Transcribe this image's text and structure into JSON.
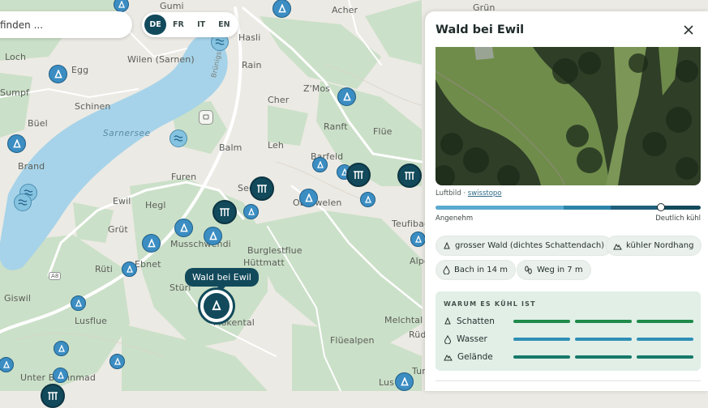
{
  "map": {
    "colors": {
      "base": "#eceae4",
      "forest": "#c9dfc6",
      "lake": "#a6d3e9",
      "road": "#ffffff"
    },
    "lake_label": "Sarnersee",
    "place_labels": [
      {
        "text": "Gumi"
      },
      {
        "text": "Acher"
      },
      {
        "text": "Grün"
      },
      {
        "text": "Hasli"
      },
      {
        "text": "Loch"
      },
      {
        "text": "Wilen (Sarnen)"
      },
      {
        "text": "Egg"
      },
      {
        "text": "Rain"
      },
      {
        "text": "Z'Mos"
      },
      {
        "text": "Sumpf"
      },
      {
        "text": "Schinen"
      },
      {
        "text": "Cher"
      },
      {
        "text": "Büel"
      },
      {
        "text": "Ranft"
      },
      {
        "text": "Flüe"
      },
      {
        "text": "Balm"
      },
      {
        "text": "Leh"
      },
      {
        "text": "Brand"
      },
      {
        "text": "Barfeld"
      },
      {
        "text": "Furen"
      },
      {
        "text": "Sed"
      },
      {
        "text": "Ewil"
      },
      {
        "text": "Hegl"
      },
      {
        "text": "Oberwelen"
      },
      {
        "text": "Teufibach"
      },
      {
        "text": "Grüt"
      },
      {
        "text": "Musschwendi"
      },
      {
        "text": "Burglestflue"
      },
      {
        "text": "Alpel"
      },
      {
        "text": "Ebnet"
      },
      {
        "text": "Rüti"
      },
      {
        "text": "Hüttmatt"
      },
      {
        "text": "Stüri"
      },
      {
        "text": "Giswil"
      },
      {
        "text": "Mokental"
      },
      {
        "text": "Lusflue"
      },
      {
        "text": "Melchtal"
      },
      {
        "text": "Rüdi"
      },
      {
        "text": "Flüealpen"
      },
      {
        "text": "Unter Brunnmad"
      },
      {
        "text": "Lus"
      },
      {
        "text": "Tur"
      }
    ],
    "road_labels": [
      {
        "text": "Brünigstrasse"
      },
      {
        "text": "A8"
      }
    ],
    "markers_count_note": "",
    "selected_marker_label": "Wald bei Ewil"
  },
  "search": {
    "placeholder": "finden ..."
  },
  "languages": [
    "DE",
    "FR",
    "IT",
    "EN"
  ],
  "active_language": "DE",
  "panel": {
    "title": "Wald bei Ewil",
    "close_icon": "close-icon",
    "photo_caption": "Luftbild",
    "photo_separator": " · ",
    "photo_source": "swisstopo",
    "scale": {
      "left_label": "Angenehm",
      "right_label": "Deutlich kühl",
      "level": 0.85,
      "colors": [
        "#5aa9cf",
        "#2d84aa",
        "#1f5f7d",
        "#124a5c"
      ]
    },
    "chips": [
      {
        "icon": "bell-tree-icon",
        "label": "grosser Wald (dichtes Schattendach)"
      },
      {
        "icon": "mountain-icon",
        "label": "kühler Nordhang"
      },
      {
        "icon": "drop-icon",
        "label": "Bach in 14 m"
      },
      {
        "icon": "footsteps-icon",
        "label": "Weg in 7 m"
      }
    ],
    "why": {
      "heading": "WARUM ES KÜHL IST",
      "rows": [
        {
          "icon": "bell-tree-icon",
          "label": "Schatten",
          "level": 3,
          "color": "#1f8a4a"
        },
        {
          "icon": "drop-icon",
          "label": "Wasser",
          "level": 3,
          "color": "#2f8fb5"
        },
        {
          "icon": "mountain-icon",
          "label": "Gelände",
          "level": 3,
          "color": "#177a6a"
        }
      ]
    }
  }
}
